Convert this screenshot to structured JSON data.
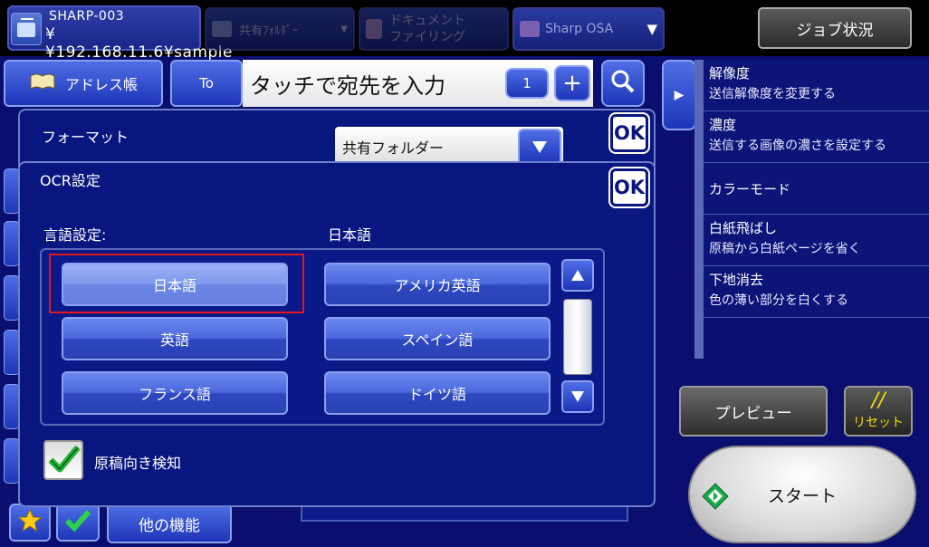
{
  "top": {
    "device_name": "SHARP-003",
    "device_path": "¥¥192.168.11.6¥sample",
    "tabs": [
      "共有ﾌｫﾙﾀﾞｰ",
      "ドキュメント\nファイリング",
      "Sharp OSA"
    ],
    "job_status": "ジョブ状況"
  },
  "address": {
    "address_book": "アドレス帳",
    "to": "To",
    "input_placeholder": "タッチで宛先を入力",
    "count": "1",
    "plus": "+"
  },
  "settings_panel": {
    "items": [
      {
        "title": "解像度",
        "sub": "送信解像度を変更する"
      },
      {
        "title": "濃度",
        "sub": "送信する画像の濃さを設定する"
      },
      {
        "title": "カラーモード",
        "sub": ""
      },
      {
        "title": "白紙飛ばし",
        "sub": "原稿から白紙ページを省く"
      },
      {
        "title": "下地消去",
        "sub": "色の薄い部分を白くする"
      }
    ]
  },
  "actions": {
    "preview": "プレビュー",
    "reset_icon": "//",
    "reset": "リセット",
    "start": "スタート",
    "other_functions": "他の機能"
  },
  "format_dialog": {
    "label": "フォーマット",
    "selected": "共有フォルダー",
    "ok": "OK"
  },
  "ocr_dialog": {
    "title": "OCR設定",
    "ok": "OK",
    "language_label": "言語設定:",
    "language_value": "日本語",
    "languages_left": [
      "日本語",
      "英語",
      "フランス語"
    ],
    "languages_right": [
      "アメリカ英語",
      "スペイン語",
      "ドイツ語"
    ],
    "selected_language": "日本語",
    "orientation_detect_label": "原稿向き検知",
    "orientation_detect_checked": true
  }
}
